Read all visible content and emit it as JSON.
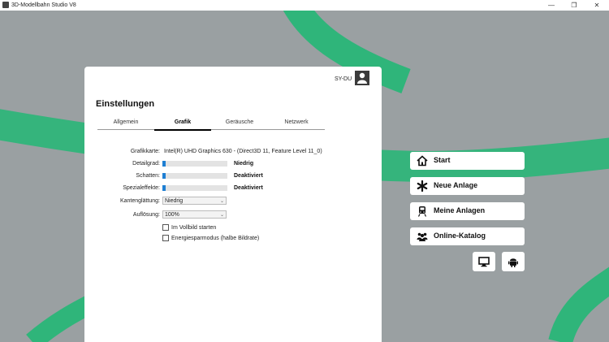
{
  "window": {
    "title": "3D-Modellbahn Studio V8",
    "minimize": "—",
    "restore": "❐",
    "close": "✕"
  },
  "panel": {
    "user": "SY-DU",
    "title": "Einstellungen",
    "tabs": [
      "Allgemein",
      "Grafik",
      "Geräusche",
      "Netzwerk"
    ],
    "active_tab": "Grafik",
    "graphics_card_label": "Grafikkarte:",
    "graphics_card_value": "Intel(R) UHD Graphics 630 - (Direct3D 11, Feature Level 11_0)",
    "detail_label": "Detailgrad:",
    "detail_value": "Niedrig",
    "detail_level": 0.05,
    "shadow_label": "Schatten:",
    "shadow_value": "Deaktiviert",
    "shadow_level": 0.05,
    "effects_label": "Spezialeffekte:",
    "effects_value": "Deaktiviert",
    "effects_level": 0.05,
    "aa_label": "Kantenglättung:",
    "aa_value": "Niedrig",
    "res_label": "Auflösung:",
    "res_value": "100%",
    "fullscreen_label": "Im Vollbild starten",
    "fullscreen_checked": false,
    "eco_label": "Energiesparmodus (halbe Bildrate)",
    "eco_checked": false
  },
  "menu": {
    "start": "Start",
    "new": "Neue Anlage",
    "mine": "Meine Anlagen",
    "catalog": "Online-Katalog"
  },
  "icons": {
    "start": "house-icon",
    "new": "asterisk-icon",
    "mine": "train-icon",
    "catalog": "people-icon",
    "desktop": "desktop-icon",
    "android": "android-icon"
  },
  "colors": {
    "accent": "#1e7fd3",
    "stripe": "#2fb57a",
    "background": "#9aa0a2"
  }
}
